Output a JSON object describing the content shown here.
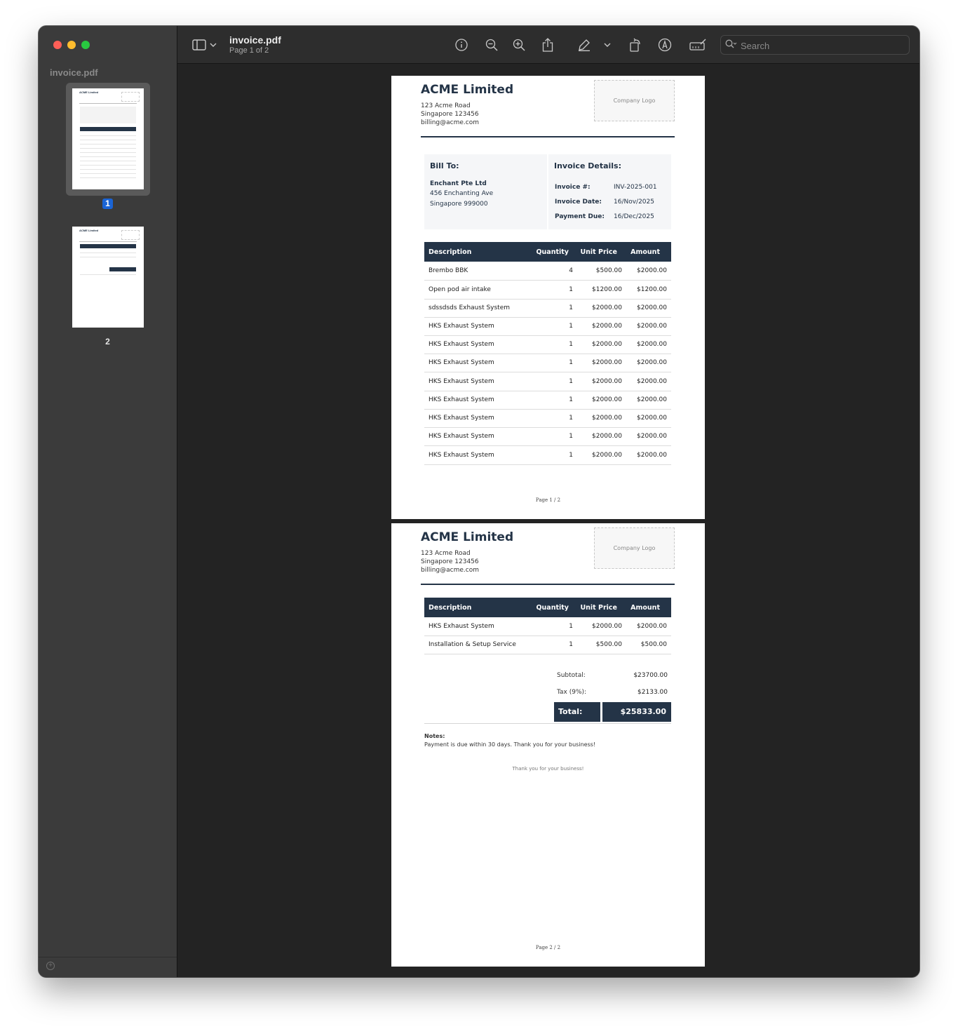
{
  "app": {
    "doc_title": "invoice.pdf",
    "page_indicator": "Page 1 of 2",
    "search_placeholder": "Search"
  },
  "sidebar": {
    "title": "invoice.pdf",
    "thumbnails": [
      {
        "label": "1",
        "selected": true
      },
      {
        "label": "2",
        "selected": false
      }
    ]
  },
  "toolbar": {
    "icons": [
      "sidebar-toggle-icon",
      "chevron-down-icon",
      "info-icon",
      "zoom-out-icon",
      "zoom-in-icon",
      "share-icon",
      "highlight-pen-icon",
      "chevron-down-icon",
      "rotate-icon",
      "markup-icon",
      "redact-icon",
      "search-icon"
    ]
  },
  "accent_color": "#243447",
  "company": {
    "name": "ACME Limited",
    "address1": "123 Acme Road",
    "address2": "Singapore 123456",
    "email": "billing@acme.com",
    "logo_placeholder": "Company Logo"
  },
  "bill_to": {
    "heading": "Bill To:",
    "name": "Enchant Pte Ltd",
    "address1": "456 Enchanting Ave",
    "address2": "Singapore 999000"
  },
  "invoice_details": {
    "heading": "Invoice Details:",
    "number_label": "Invoice #:",
    "number": "INV-2025-001",
    "date_label": "Invoice Date:",
    "date": "16/Nov/2025",
    "due_label": "Payment Due:",
    "due": "16/Dec/2025"
  },
  "table_headers": {
    "description": "Description",
    "quantity": "Quantity",
    "unit_price": "Unit Price",
    "amount": "Amount"
  },
  "page1_items": [
    {
      "description": "Brembo BBK",
      "quantity": "4",
      "unit_price": "$500.00",
      "amount": "$2000.00"
    },
    {
      "description": "Open pod air intake",
      "quantity": "1",
      "unit_price": "$1200.00",
      "amount": "$1200.00"
    },
    {
      "description": "sdssdsds Exhaust System",
      "quantity": "1",
      "unit_price": "$2000.00",
      "amount": "$2000.00"
    },
    {
      "description": "HKS Exhaust System",
      "quantity": "1",
      "unit_price": "$2000.00",
      "amount": "$2000.00"
    },
    {
      "description": "HKS Exhaust System",
      "quantity": "1",
      "unit_price": "$2000.00",
      "amount": "$2000.00"
    },
    {
      "description": "HKS Exhaust System",
      "quantity": "1",
      "unit_price": "$2000.00",
      "amount": "$2000.00"
    },
    {
      "description": "HKS Exhaust System",
      "quantity": "1",
      "unit_price": "$2000.00",
      "amount": "$2000.00"
    },
    {
      "description": "HKS Exhaust System",
      "quantity": "1",
      "unit_price": "$2000.00",
      "amount": "$2000.00"
    },
    {
      "description": "HKS Exhaust System",
      "quantity": "1",
      "unit_price": "$2000.00",
      "amount": "$2000.00"
    },
    {
      "description": "HKS Exhaust System",
      "quantity": "1",
      "unit_price": "$2000.00",
      "amount": "$2000.00"
    },
    {
      "description": "HKS Exhaust System",
      "quantity": "1",
      "unit_price": "$2000.00",
      "amount": "$2000.00"
    }
  ],
  "page2_items": [
    {
      "description": "HKS Exhaust System",
      "quantity": "1",
      "unit_price": "$2000.00",
      "amount": "$2000.00"
    },
    {
      "description": "Installation & Setup Service",
      "quantity": "1",
      "unit_price": "$500.00",
      "amount": "$500.00"
    }
  ],
  "totals": {
    "subtotal_label": "Subtotal:",
    "subtotal": "$23700.00",
    "tax_label": "Tax (9%):",
    "tax": "$2133.00",
    "total_label": "Total:",
    "total": "$25833.00"
  },
  "notes": {
    "heading": "Notes:",
    "text": "Payment is due within 30 days. Thank you for your business!"
  },
  "thanks": "Thank you for your business!",
  "page_footers": [
    "Page 1 / 2",
    "Page 2 / 2"
  ]
}
